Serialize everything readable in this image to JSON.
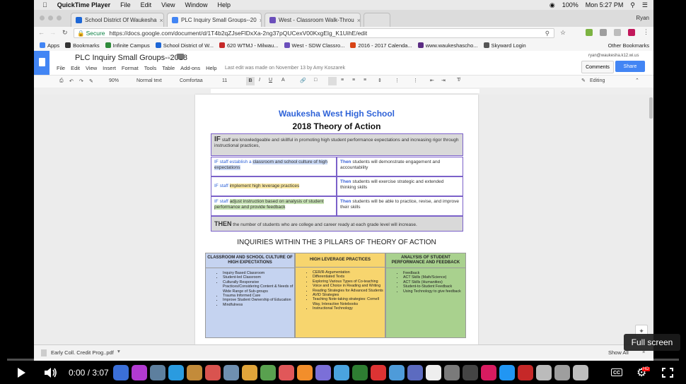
{
  "menubar": {
    "apple": "",
    "app": "QuickTime Player",
    "items": [
      "File",
      "Edit",
      "View",
      "Window",
      "Help"
    ],
    "battery": "100%",
    "clock": "Mon 5:27 PM"
  },
  "browser": {
    "tabs": [
      {
        "label": "School District Of Waukesha",
        "color": "#1c66d6"
      },
      {
        "label": "PLC Inquiry Small Groups--20",
        "color": "#4285f4"
      },
      {
        "label": "West - Classroom Walk-Throu",
        "color": "#6b4fbb"
      }
    ],
    "profile": "Ryan",
    "secure_label": "Secure",
    "url": "https://docs.google.com/document/d/1T4b2qZJseFlDxXa-2ng37pQUCexV00KxgElg_K1UihE/edit",
    "bookmarks": [
      {
        "label": "Apps",
        "color": "#4285f4"
      },
      {
        "label": "Bookmarks",
        "color": "#333333"
      },
      {
        "label": "Infinite Campus",
        "color": "#2e8b3a"
      },
      {
        "label": "School District of W...",
        "color": "#1c66d6"
      },
      {
        "label": "620 WTMJ - Milwau...",
        "color": "#c62828"
      },
      {
        "label": "West - SDW Classro...",
        "color": "#6b4fbb"
      },
      {
        "label": "2016 - 2017 Calenda...",
        "color": "#d84315"
      },
      {
        "label": "www.waukeshascho...",
        "color": "#5b2c83"
      },
      {
        "label": "Skyward Login",
        "color": "#555555"
      }
    ],
    "other_bookmarks": "Other Bookmarks"
  },
  "docs": {
    "title": "PLC Inquiry Small Groups--2018",
    "menus": [
      "File",
      "Edit",
      "View",
      "Insert",
      "Format",
      "Tools",
      "Table",
      "Add-ons",
      "Help"
    ],
    "last_edit": "Last edit was made on November 13 by Amy Koszarek",
    "account": "ryan@waukesha.k12.wi.us",
    "comments": "Comments",
    "share": "Share",
    "toolbar": {
      "zoom": "90%",
      "style": "Normal text",
      "font": "Comfortaa",
      "size": "11",
      "mode": "Editing"
    }
  },
  "document": {
    "school": "Waukesha West High School",
    "heading": "2018 Theory of Action",
    "if_word": "IF",
    "if_text": " staff are knowledgeable and skillful in promoting high student performance expectations and increasing rigor through instructional practices,",
    "rows": [
      {
        "if_prefix": "IF staff establish a ",
        "if_hl": "classroom and school culture of high expectations",
        "then_word": "Then",
        "then_text": " students will demonstrate engagement and accountability"
      },
      {
        "if_prefix": "IF staff ",
        "if_hl": "implement high leverage practices",
        "then_word": "Then",
        "then_text": " students will exercise strategic and extended thinking skills"
      },
      {
        "if_prefix": "IF staff ",
        "if_hl": "adjust instruction based on analysis of student performance and provide feedback",
        "then_word": "Then",
        "then_text": " students will be able to practice, revise, and improve their skills"
      }
    ],
    "then_word": "THEN",
    "then_text": " the number of students who are college and career ready at each grade level will increase.",
    "inquiries_title": "INQUIRIES WITHIN THE 3 PILLARS OF THEORY OF ACTION",
    "pillars": [
      {
        "title": "CLASSROOM AND SCHOOL CULTURE OF HIGH EXPECTATIONS",
        "color": "#c5d3f0",
        "items": [
          "Inquiry Based Classroom",
          "Student-led Classroom",
          "Culturally Responsive Practices/Considering Content & Needs of Wide Range of Sub-groups",
          "Trauma Informed Care",
          "Improve Student Ownership of Education",
          "Mindfulness"
        ]
      },
      {
        "title": "HIGH LEVERAGE PRACTICES",
        "color": "#f7d56e",
        "items": [
          "CER/R-Argumentation",
          "Differentiated Texts",
          "Exploring Various Types of Co-teaching",
          "Voice and Choice in Reading and Writing",
          "Reading Strategies for Advanced Students",
          "AVID Strategies",
          "Teaching Note-taking strategies: Cornell Way, Interactive Notebooks",
          "Instructional Technology"
        ]
      },
      {
        "title": "ANALYSIS OF STUDENT PERFORMANCE AND FEEDBACK",
        "color": "#a9d18e",
        "items": [
          "Feedback",
          "ACT Skills (Math/Science)",
          "ACT Skills (Humanities)",
          "Student-to-Student Feedback",
          "Using Technology to give feedback"
        ]
      }
    ]
  },
  "download": {
    "file": "Early Coll. Credit Prog..pdf",
    "show_all": "Show All"
  },
  "video": {
    "time": "0:00 / 3:07",
    "tooltip": "Full screen",
    "progress": 0.0,
    "hd": "HD",
    "cc": "CC"
  }
}
